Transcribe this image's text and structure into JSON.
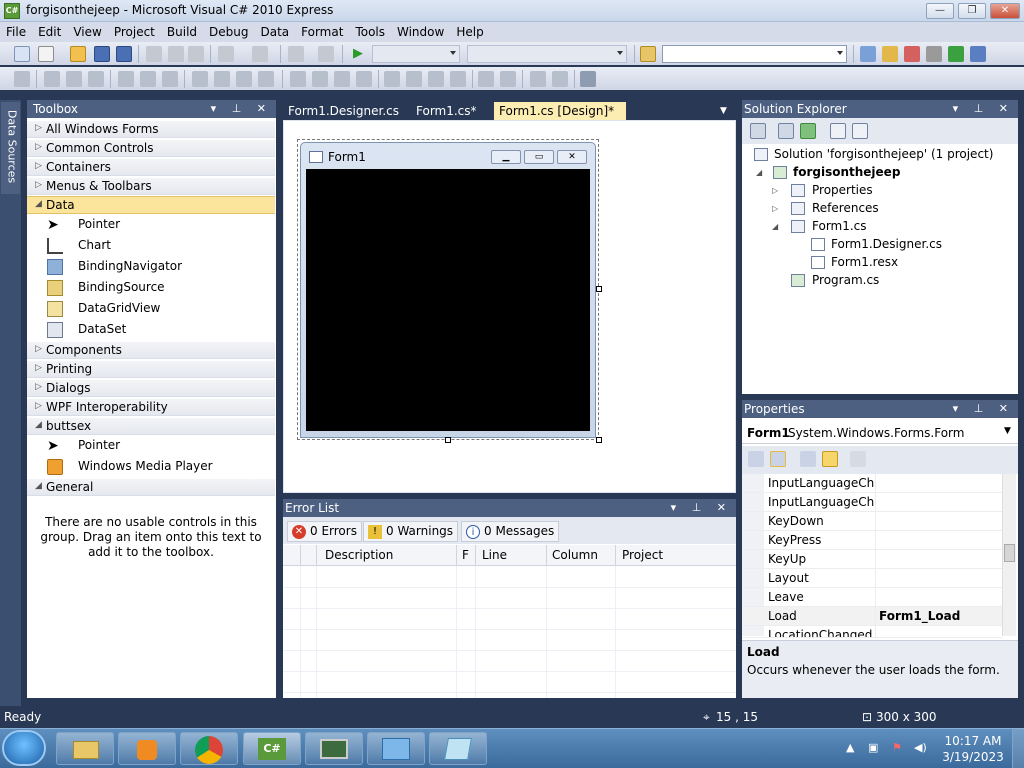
{
  "window": {
    "title": "forgisonthejeep - Microsoft Visual C# 2010 Express",
    "app_icon": "vs-csharp-icon",
    "minimize_glyph": "—",
    "maximize_glyph": "❐",
    "close_glyph": "✕"
  },
  "menu": [
    "File",
    "Edit",
    "View",
    "Project",
    "Build",
    "Debug",
    "Data",
    "Format",
    "Tools",
    "Window",
    "Help"
  ],
  "toolbox": {
    "title": "Toolbox",
    "groups": {
      "all_windows_forms": "All Windows Forms",
      "common_controls": "Common Controls",
      "containers": "Containers",
      "menus_toolbars": "Menus & Toolbars",
      "data": "Data",
      "components": "Components",
      "printing": "Printing",
      "dialogs": "Dialogs",
      "wpf_interop": "WPF Interoperability",
      "buttsex": "buttsex",
      "general": "General"
    },
    "data_items": [
      "Pointer",
      "Chart",
      "BindingNavigator",
      "BindingSource",
      "DataGridView",
      "DataSet"
    ],
    "buttsex_items": [
      "Pointer",
      "Windows Media Player"
    ],
    "general_empty": "There are no usable controls in this group. Drag an item onto this text to add it to the toolbox."
  },
  "side_tab": {
    "label": "Data Sources"
  },
  "doc_tabs": [
    {
      "label": "Form1.Designer.cs"
    },
    {
      "label": "Form1.cs*"
    },
    {
      "label": "Form1.cs [Design]*",
      "close": "✕"
    }
  ],
  "form": {
    "title": "Form1"
  },
  "error_list": {
    "title": "Error List",
    "errors": "0 Errors",
    "warnings": "0 Warnings",
    "messages": "0 Messages",
    "columns": {
      "description": "Description",
      "file": "F",
      "line": "Line",
      "column": "Column",
      "project": "Project"
    }
  },
  "solution_explorer": {
    "title": "Solution Explorer",
    "solution": "Solution 'forgisonthejeep' (1 project)",
    "project": "forgisonthejeep",
    "properties": "Properties",
    "references": "References",
    "form1": "Form1.cs",
    "designer": "Form1.Designer.cs",
    "resx": "Form1.resx",
    "program": "Program.cs"
  },
  "properties": {
    "title": "Properties",
    "object_name": "Form1",
    "object_type": "System.Windows.Forms.Form",
    "rows": [
      {
        "name": "InputLanguageChar",
        "value": ""
      },
      {
        "name": "InputLanguageChar",
        "value": ""
      },
      {
        "name": "KeyDown",
        "value": ""
      },
      {
        "name": "KeyPress",
        "value": ""
      },
      {
        "name": "KeyUp",
        "value": ""
      },
      {
        "name": "Layout",
        "value": ""
      },
      {
        "name": "Leave",
        "value": ""
      },
      {
        "name": "Load",
        "value": "Form1_Load"
      },
      {
        "name": "LocationChanged",
        "value": ""
      }
    ],
    "desc_title": "Load",
    "desc_text": "Occurs whenever the user loads the form."
  },
  "status": {
    "text": "Ready",
    "position": "15 , 15",
    "size": "300 x 300"
  },
  "taskbar": {
    "time": "10:17 AM",
    "date": "3/19/2023"
  }
}
